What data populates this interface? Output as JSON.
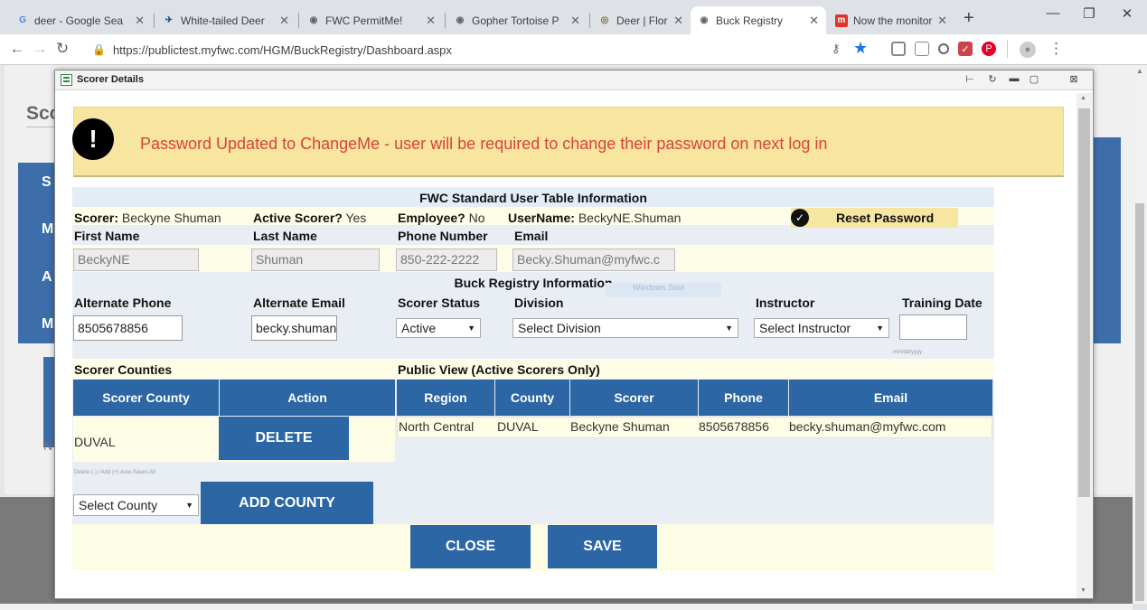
{
  "browser": {
    "tabs": [
      {
        "title": "deer - Google Sea",
        "icon": "google-icon",
        "active": false
      },
      {
        "title": "White-tailed Deer",
        "icon": "deer-site-icon",
        "active": false
      },
      {
        "title": "FWC PermitMe!",
        "icon": "globe-icon",
        "active": false
      },
      {
        "title": "Gopher Tortoise P",
        "icon": "globe-icon",
        "active": false
      },
      {
        "title": "Deer | Florida Fish",
        "icon": "fwc-seal-icon",
        "active": false
      },
      {
        "title": "Buck Registry",
        "icon": "globe-icon",
        "active": true
      },
      {
        "title": "Now the monitori",
        "icon": "m-icon",
        "active": false
      }
    ],
    "new_tab": "+",
    "url": "https://publictest.myfwc.com/HGM/BuckRegistry/Dashboard.aspx"
  },
  "background_page": {
    "heading": "Sco",
    "rows": [
      "S",
      "M",
      "A",
      "M"
    ],
    "footer_letter": "N"
  },
  "dialog": {
    "title": "Scorer Details",
    "alert": {
      "message": "Password Updated to ChangeMe - user will be required to change their password on next log in",
      "icon": "!"
    },
    "user_table": {
      "heading": "FWC Standard User Table Information",
      "scorer_label": "Scorer:",
      "scorer_value": "Beckyne Shuman",
      "active_label": "Active Scorer?",
      "active_value": "Yes",
      "employee_label": "Employee?",
      "employee_value": "No",
      "username_label": "UserName:",
      "username_value": "BeckyNE.Shuman",
      "reset_password": "Reset Password",
      "first_name_label": "First Name",
      "first_name_value": "BeckyNE",
      "last_name_label": "Last Name",
      "last_name_value": "Shuman",
      "phone_label": "Phone Number",
      "phone_value": "850-222-2222",
      "email_label": "Email",
      "email_value": "Becky.Shuman@myfwc.c"
    },
    "buck_registry": {
      "heading": "Buck Registry Information",
      "alt_phone_label": "Alternate Phone",
      "alt_phone_value": "8505678856",
      "alt_email_label": "Alternate Email",
      "alt_email_value": "becky.shuman@m",
      "status_label": "Scorer Status",
      "status_value": "Active",
      "division_label": "Division",
      "division_value": "Select Division",
      "instructor_label": "Instructor",
      "instructor_value": "Select Instructor",
      "training_label": "Training Date",
      "training_value": "",
      "training_hint": "mm/dd/yyyy",
      "watermark": "Windows Sour"
    },
    "counties": {
      "heading": "Scorer Counties",
      "col_county": "Scorer County",
      "col_action": "Action",
      "rows": [
        {
          "county": "DUVAL",
          "action": "DELETE"
        }
      ],
      "hint": "Delete (-) / Add (+) Auto-Saves All",
      "select_value": "Select County",
      "add_button": "ADD COUNTY"
    },
    "public_view": {
      "heading": "Public View (Active Scorers Only)",
      "columns": [
        "Region",
        "County",
        "Scorer",
        "Phone",
        "Email"
      ],
      "rows": [
        [
          "North Central",
          "DUVAL",
          "Beckyne Shuman",
          "8505678856",
          "becky.shuman@myfwc.com"
        ]
      ]
    },
    "buttons": {
      "close": "CLOSE",
      "save": "SAVE"
    }
  }
}
